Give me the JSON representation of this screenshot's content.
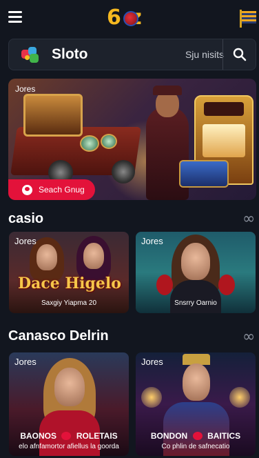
{
  "header": {
    "logo_text": "6 z",
    "menu_icon": "hamburger-icon",
    "flag_icon": "flag-icon"
  },
  "search": {
    "brand_name": "Sloto",
    "placeholder": "Sju nisits",
    "search_icon": "search-icon"
  },
  "hero": {
    "tag": "Jores",
    "cta_label": "Seach Gnug",
    "cta_icon": "user-circle-icon"
  },
  "sections": [
    {
      "title": "casio",
      "more_icon": "infinity-icon",
      "cards": [
        {
          "tag": "Jores",
          "title": "Dace Higelo",
          "caption": "Saxgiy Yiapma 20"
        },
        {
          "tag": "Jores",
          "caption": "Snsrry Oarnio"
        }
      ]
    },
    {
      "title": "Canasco Delrin",
      "more_icon": "infinity-icon",
      "cards": [
        {
          "tag": "Jores",
          "title_left": "BAONOS",
          "title_right": "ROLETAIS",
          "caption": "elo afnfamortor afiellus la goorda"
        },
        {
          "tag": "Jores",
          "title_left": "BONDON",
          "title_right": "BAITICS",
          "caption": "Co phlin de safnecatio"
        }
      ]
    }
  ],
  "colors": {
    "background": "#12161f",
    "accent_red": "#e3123a",
    "logo_gold": "#f5b820"
  }
}
